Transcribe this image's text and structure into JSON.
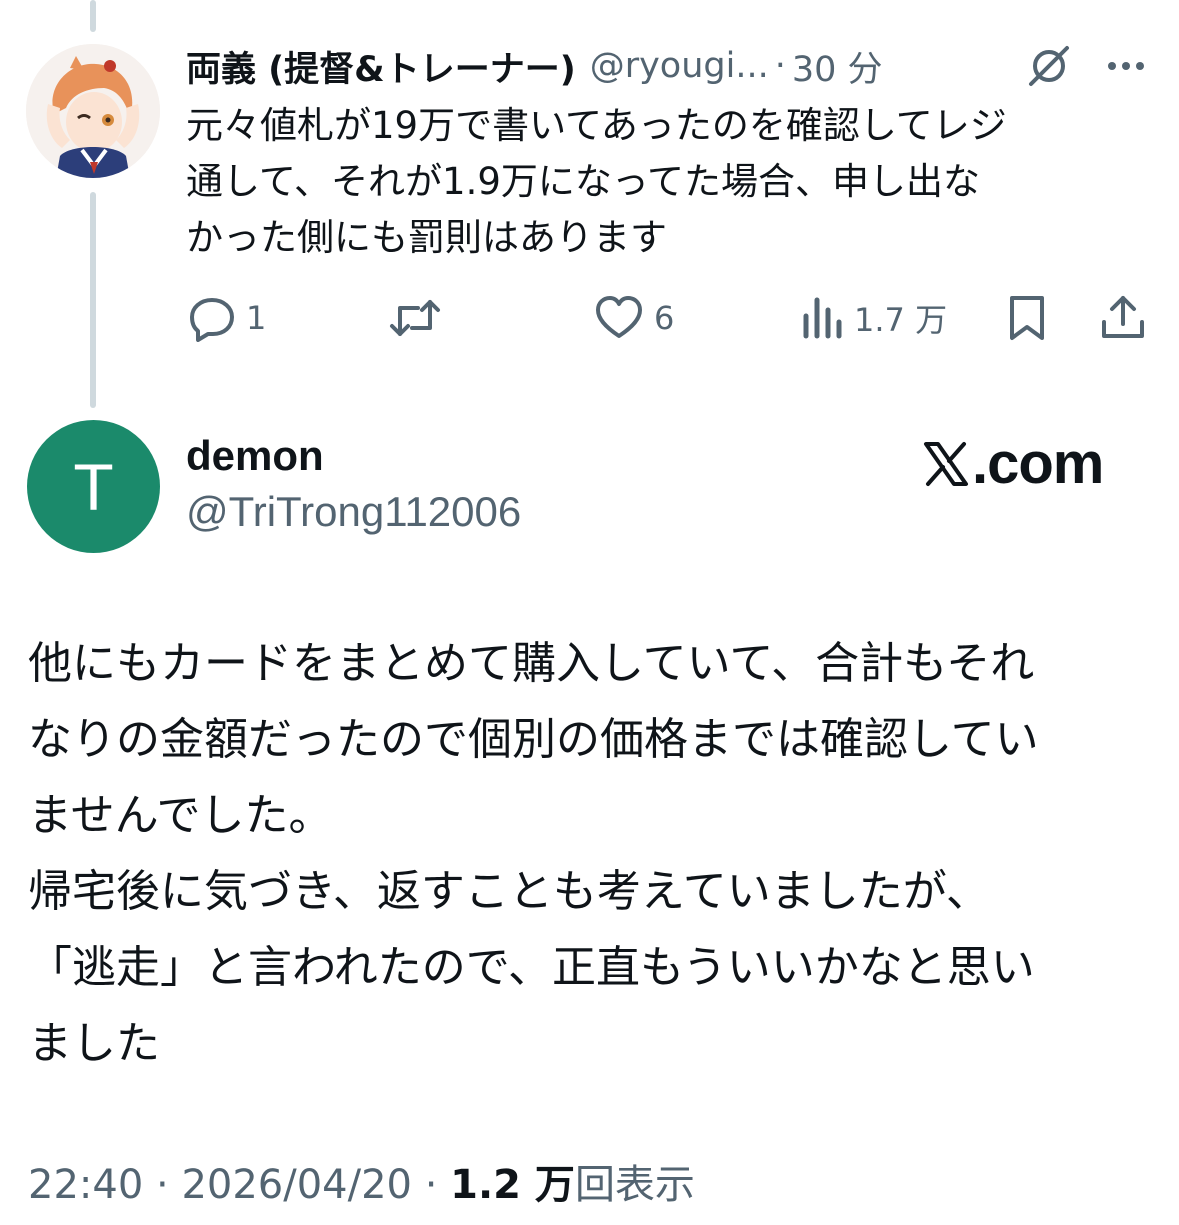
{
  "tweet1": {
    "author_name": "両義 (提督&トレーナー)",
    "handle": "@ryougi...",
    "separator": "·",
    "time": "30 分",
    "body_lines": [
      "元々値札が19万で書いてあったのを確認してレジ",
      "通して、それが1.9万になってた場合、申し出な",
      "かった側にも罰則はあります"
    ],
    "actions": {
      "reply_count": "1",
      "retweet_count": "",
      "like_count": "6",
      "views_count": "1.7 万"
    },
    "icons": [
      "grok-icon",
      "more-icon",
      "reply-icon",
      "retweet-icon",
      "like-icon",
      "views-icon",
      "bookmark-icon",
      "share-icon"
    ]
  },
  "tweet2": {
    "avatar_letter": "T",
    "avatar_color": "#1b8a6b",
    "author_name": "demon",
    "handle": "@TriTrong112006",
    "watermark": ".com",
    "body_lines": [
      "他にもカードをまとめて購入していて、合計もそれ",
      "なりの金額だったので個別の価格までは確認してい",
      "ませんでした。",
      "帰宅後に気づき、返すことも考えていましたが、",
      "「逃走」と言われたので、正直もういいかなと思い",
      "ました"
    ],
    "footer": {
      "time": "22:40",
      "sep1": " · ",
      "date": "2026/04/20",
      "sep2": " · ",
      "views_count": "1.2 万",
      "views_label": "回表示"
    }
  },
  "colors": {
    "text": "#0f1419",
    "secondary": "#536471",
    "thread_line": "#cfd9de"
  }
}
